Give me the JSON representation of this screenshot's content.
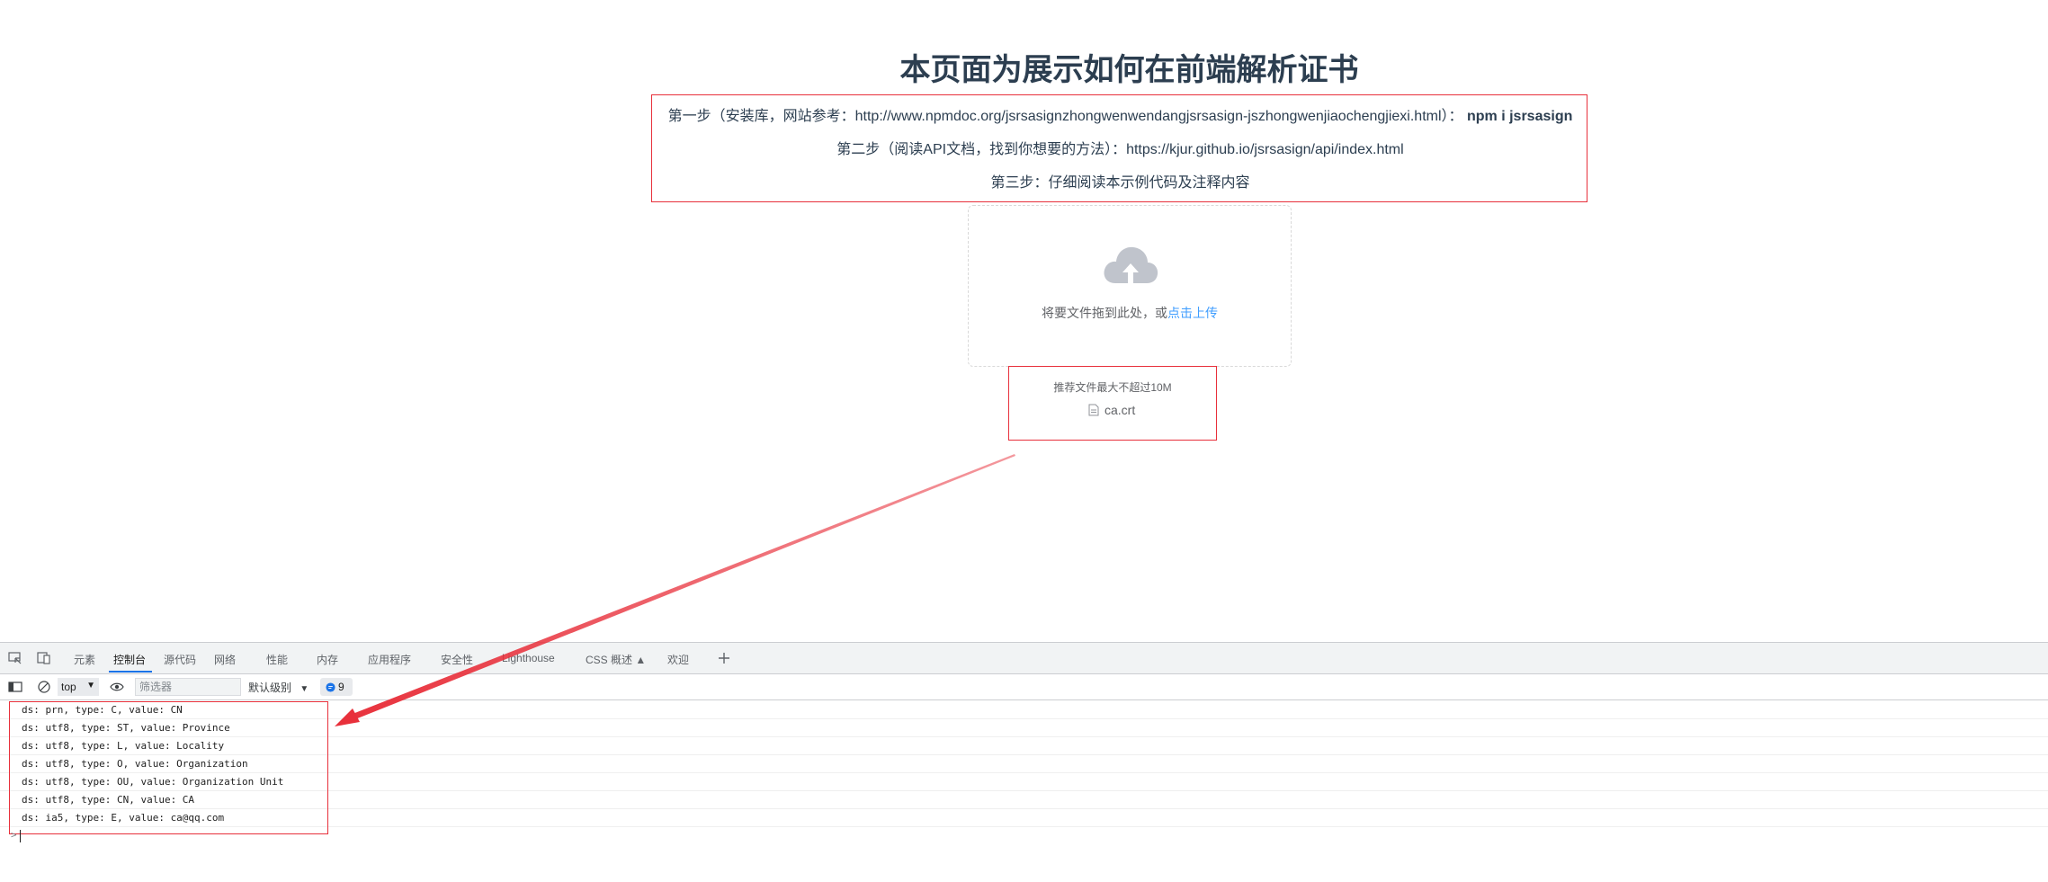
{
  "page": {
    "title": "本页面为展示如何在前端解析证书",
    "steps": [
      {
        "text": "第一步（安装库，网站参考：http://www.npmdoc.org/jsrsasignzhongwenwendangjsrsasign-jszhongwenjiaochengjiexi.html）：",
        "bold": "npm i jsrsasign"
      },
      {
        "text": "第二步（阅读API文档，找到你想要的方法）：https://kjur.github.io/jsrsasign/api/index.html",
        "bold": ""
      },
      {
        "text": "第三步：仔细阅读本示例代码及注释内容",
        "bold": ""
      }
    ]
  },
  "upload": {
    "icon": "upload-cloud-icon",
    "drag_text": "将要文件拖到此处，或",
    "click_text": "点击上传",
    "tip": "推荐文件最大不超过10M",
    "files": [
      {
        "name": "ca.crt",
        "icon": "document-icon"
      }
    ]
  },
  "annotation": {
    "color": "#e8303b"
  },
  "devtools": {
    "tabs": [
      {
        "label": "元素"
      },
      {
        "label": "控制台",
        "active": true
      },
      {
        "label": "源代码"
      },
      {
        "label": "网络"
      },
      {
        "label": "性能"
      },
      {
        "label": "内存"
      },
      {
        "label": "应用程序"
      },
      {
        "label": "安全性"
      },
      {
        "label": "Lighthouse"
      },
      {
        "label": "CSS 概述 ▲"
      },
      {
        "label": "欢迎"
      }
    ],
    "toolbar": {
      "context": "top",
      "filter_placeholder": "筛选器",
      "level": "默认级别",
      "issues_count": "9"
    },
    "logs": [
      "ds: prn, type: C, value: CN",
      "ds: utf8, type: ST, value: Province",
      "ds: utf8, type: L, value: Locality",
      "ds: utf8, type: O, value: Organization",
      "ds: utf8, type: OU, value: Organization Unit",
      "ds: utf8, type: CN, value: CA",
      "ds: ia5, type: E, value: ca@qq.com"
    ],
    "prompt": ">"
  },
  "colors": {
    "accent": "#409eff",
    "devtools_active": "#1a73e8",
    "highlight": "#e8303b"
  }
}
